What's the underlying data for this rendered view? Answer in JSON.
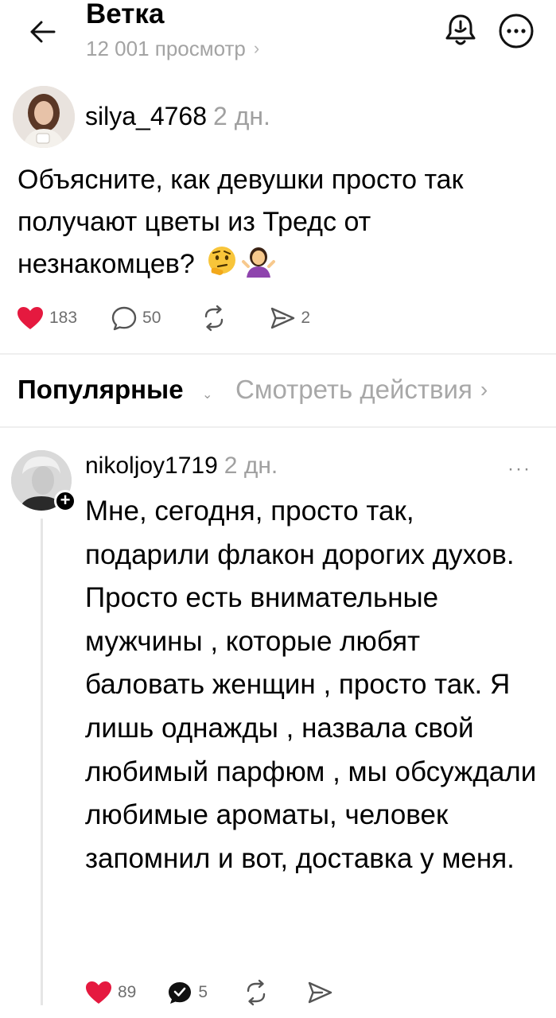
{
  "header": {
    "title": "Ветка",
    "views": "12 001 просмотр"
  },
  "post": {
    "username": "silya_4768",
    "time": "2 дн.",
    "text": "Объясните, как девушки просто так получают цветы из Тредс от незнакомцев?",
    "emojis": [
      "thinking-face",
      "woman-shrugging"
    ],
    "likes": "183",
    "replies": "50",
    "shares": "2"
  },
  "sort": {
    "label": "Популярные",
    "activity_link": "Смотреть действия"
  },
  "comment": {
    "username": "nikoljoy1719",
    "time": "2 дн.",
    "text": "Мне, сегодня, просто так, подарили флакон дорогих духов. Просто  есть внимательные мужчины , которые любят баловать женщин , просто так. Я лишь однажды , назвала свой любимый парфюм , мы обсуждали  любимые ароматы, человек запомнил и вот, доставка у меня.",
    "likes": "89",
    "replies": "5"
  },
  "colors": {
    "like_red": "#e5193f",
    "muted_text": "#a0a0a0"
  }
}
